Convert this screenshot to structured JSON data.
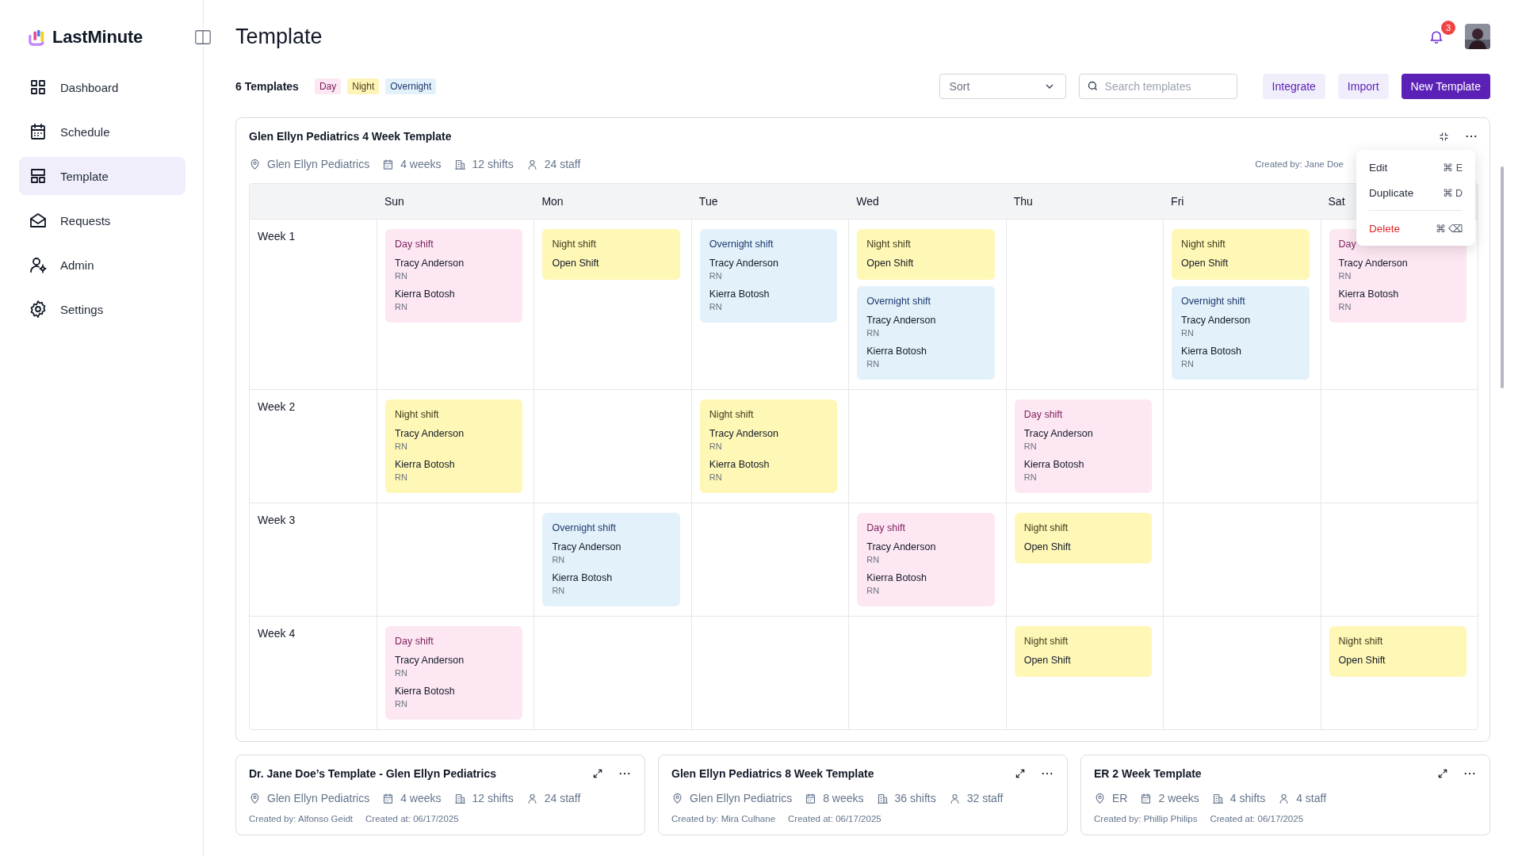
{
  "brand": {
    "name": "LastMinute"
  },
  "sidebar": {
    "items": [
      {
        "label": "Dashboard",
        "selected": false
      },
      {
        "label": "Schedule",
        "selected": false
      },
      {
        "label": "Template",
        "selected": true
      },
      {
        "label": "Requests",
        "selected": false
      },
      {
        "label": "Admin",
        "selected": false
      },
      {
        "label": "Settings",
        "selected": false
      }
    ]
  },
  "header": {
    "title": "Template",
    "notification_count": "3"
  },
  "toolbar": {
    "count": "6 Templates",
    "legend": [
      {
        "label": "Day",
        "kind": "day"
      },
      {
        "label": "Night",
        "kind": "night"
      },
      {
        "label": "Overnight",
        "kind": "overnight"
      }
    ],
    "sort": {
      "placeholder": "Sort"
    },
    "search": {
      "placeholder": "Search templates"
    },
    "buttons": [
      {
        "label": "Integrate",
        "kind": "secondary"
      },
      {
        "label": "Import",
        "kind": "secondary"
      },
      {
        "label": "New Template",
        "kind": "primary"
      }
    ]
  },
  "featured": {
    "title": "Glen Ellyn Pediatrics 4 Week Template",
    "meta": [
      {
        "kind": "location",
        "text": "Glen Ellyn Pediatrics"
      },
      {
        "kind": "duration",
        "text": "4 weeks"
      },
      {
        "kind": "shifts",
        "text": "12 shifts"
      },
      {
        "kind": "staff",
        "text": "24 staff"
      }
    ],
    "created_by": "Created by: Jane Doe",
    "menu": [
      {
        "label": "Edit",
        "shortcut": "⌘ E",
        "kind": "normal"
      },
      {
        "label": "Duplicate",
        "shortcut": "⌘ D",
        "kind": "normal"
      },
      {
        "label": "Delete",
        "shortcut": "⌘ ⌫",
        "kind": "danger"
      }
    ],
    "days": [
      "Sun",
      "Mon",
      "Tue",
      "Wed",
      "Thu",
      "Fri",
      "Sat"
    ],
    "weeks": [
      {
        "label": "Week 1",
        "sun": [
          {
            "kind": "day",
            "title": "Day shift",
            "staff": [
              {
                "name": "Tracy Anderson",
                "role": "RN"
              },
              {
                "name": "Kierra Botosh",
                "role": "RN"
              }
            ]
          }
        ],
        "mon": [
          {
            "kind": "night",
            "title": "Night shift",
            "staff": [
              {
                "name": "Open Shift"
              }
            ]
          }
        ],
        "tue": [
          {
            "kind": "overnight",
            "title": "Overnight shift",
            "staff": [
              {
                "name": "Tracy Anderson",
                "role": "RN"
              },
              {
                "name": "Kierra Botosh",
                "role": "RN"
              }
            ]
          }
        ],
        "wed": [
          {
            "kind": "night",
            "title": "Night shift",
            "staff": [
              {
                "name": "Open Shift"
              }
            ]
          },
          {
            "kind": "overnight",
            "title": "Overnight shift",
            "staff": [
              {
                "name": "Tracy Anderson",
                "role": "RN"
              },
              {
                "name": "Kierra Botosh",
                "role": "RN"
              }
            ]
          }
        ],
        "fri": [
          {
            "kind": "night",
            "title": "Night shift",
            "staff": [
              {
                "name": "Open Shift"
              }
            ]
          },
          {
            "kind": "overnight",
            "title": "Overnight shift",
            "staff": [
              {
                "name": "Tracy Anderson",
                "role": "RN"
              },
              {
                "name": "Kierra Botosh",
                "role": "RN"
              }
            ]
          }
        ],
        "sat": [
          {
            "kind": "day",
            "title": "Day",
            "staff": [
              {
                "name": "Tracy Anderson",
                "role": "RN"
              },
              {
                "name": "Kierra Botosh",
                "role": "RN"
              }
            ]
          }
        ]
      },
      {
        "label": "Week 2",
        "sun": [
          {
            "kind": "night",
            "title": "Night shift",
            "staff": [
              {
                "name": "Tracy Anderson",
                "role": "RN"
              },
              {
                "name": "Kierra Botosh",
                "role": "RN"
              }
            ]
          }
        ],
        "tue": [
          {
            "kind": "night",
            "title": "Night shift",
            "staff": [
              {
                "name": "Tracy Anderson",
                "role": "RN"
              },
              {
                "name": "Kierra Botosh",
                "role": "RN"
              }
            ]
          }
        ],
        "thu": [
          {
            "kind": "day",
            "title": "Day shift",
            "staff": [
              {
                "name": "Tracy Anderson",
                "role": "RN"
              },
              {
                "name": "Kierra Botosh",
                "role": "RN"
              }
            ]
          }
        ]
      },
      {
        "label": "Week 3",
        "mon": [
          {
            "kind": "overnight",
            "title": "Overnight shift",
            "staff": [
              {
                "name": "Tracy Anderson",
                "role": "RN"
              },
              {
                "name": "Kierra Botosh",
                "role": "RN"
              }
            ]
          }
        ],
        "wed": [
          {
            "kind": "day",
            "title": "Day shift",
            "staff": [
              {
                "name": "Tracy Anderson",
                "role": "RN"
              },
              {
                "name": "Kierra Botosh",
                "role": "RN"
              }
            ]
          }
        ],
        "thu": [
          {
            "kind": "night",
            "title": "Night shift",
            "staff": [
              {
                "name": "Open Shift"
              }
            ]
          }
        ]
      },
      {
        "label": "Week 4",
        "sun": [
          {
            "kind": "day",
            "title": "Day shift",
            "staff": [
              {
                "name": "Tracy Anderson",
                "role": "RN"
              },
              {
                "name": "Kierra Botosh",
                "role": "RN"
              }
            ]
          }
        ],
        "thu": [
          {
            "kind": "night",
            "title": "Night shift",
            "staff": [
              {
                "name": "Open Shift"
              }
            ]
          }
        ],
        "sat": [
          {
            "kind": "night",
            "title": "Night shift",
            "staff": [
              {
                "name": "Open Shift"
              }
            ]
          }
        ]
      }
    ]
  },
  "templates": [
    {
      "title": "Dr. Jane Doe’s Template - Glen Ellyn Pediatrics",
      "meta": [
        {
          "kind": "location",
          "text": "Glen Ellyn Pediatrics"
        },
        {
          "kind": "duration",
          "text": "4 weeks"
        },
        {
          "kind": "shifts",
          "text": "12 shifts"
        },
        {
          "kind": "staff",
          "text": "24 staff"
        }
      ],
      "created_by": "Created by: Alfonso Geidt",
      "created_at": "Created at: 06/17/2025"
    },
    {
      "title": "Glen Ellyn Pediatrics 8 Week Template",
      "meta": [
        {
          "kind": "location",
          "text": "Glen Ellyn Pediatrics"
        },
        {
          "kind": "duration",
          "text": "8 weeks"
        },
        {
          "kind": "shifts",
          "text": "36 shifts"
        },
        {
          "kind": "staff",
          "text": "32 staff"
        }
      ],
      "created_by": "Created by: Mira Culhane",
      "created_at": "Created at: 06/17/2025"
    },
    {
      "title": "ER 2 Week Template",
      "meta": [
        {
          "kind": "location",
          "text": "ER"
        },
        {
          "kind": "duration",
          "text": "2 weeks"
        },
        {
          "kind": "shifts",
          "text": "4 shifts"
        },
        {
          "kind": "staff",
          "text": "4 staff"
        }
      ],
      "created_by": "Created by: Phillip Philips",
      "created_at": "Created at: 06/17/2025"
    }
  ]
}
